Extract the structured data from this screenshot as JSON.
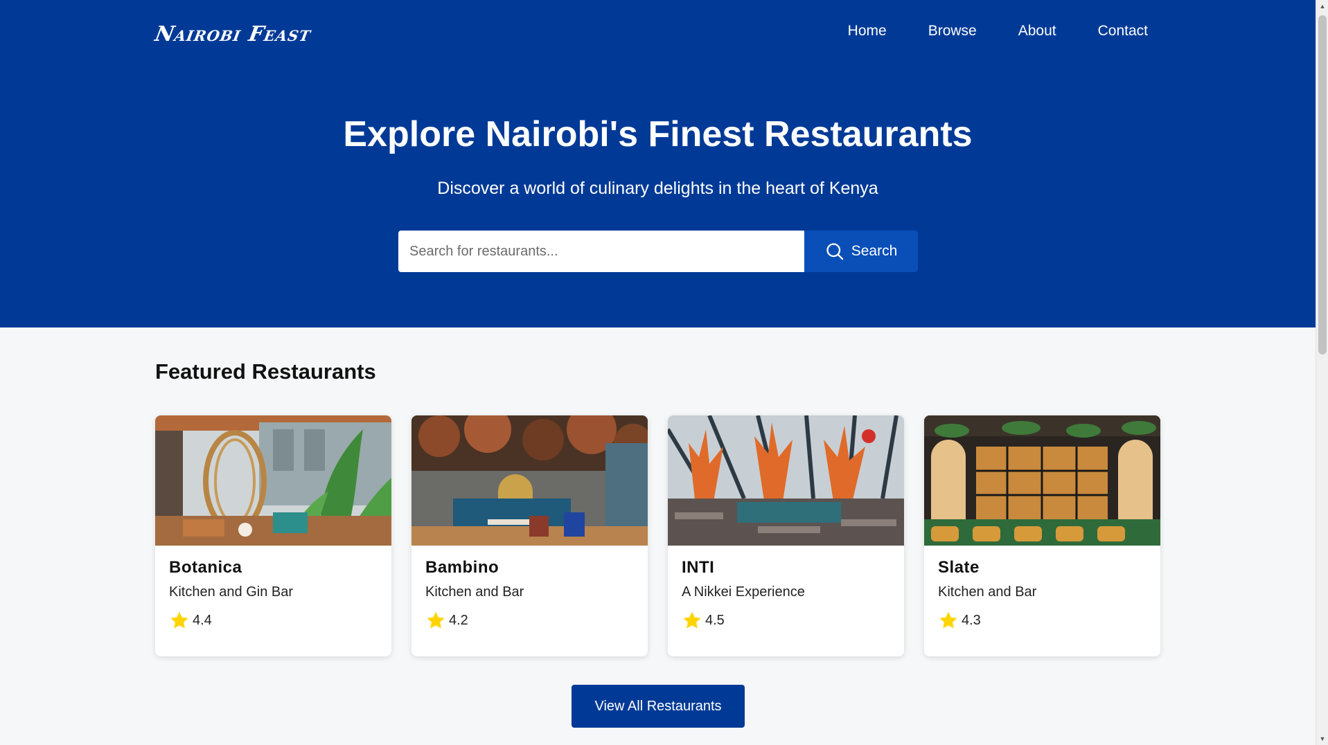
{
  "header": {
    "logo": "Nairobi Feast",
    "nav": [
      "Home",
      "Browse",
      "About",
      "Contact"
    ]
  },
  "hero": {
    "title": "Explore Nairobi's Finest Restaurants",
    "subtitle": "Discover a world of culinary delights in the heart of Kenya",
    "search_placeholder": "Search for restaurants...",
    "search_button": "Search"
  },
  "featured": {
    "title": "Featured Restaurants",
    "restaurants": [
      {
        "name": "Botanica",
        "description": "Kitchen and Gin Bar",
        "rating": "4.4"
      },
      {
        "name": "Bambino",
        "description": "Kitchen and Bar",
        "rating": "4.2"
      },
      {
        "name": "INTI",
        "description": "A Nikkei Experience",
        "rating": "4.5"
      },
      {
        "name": "Slate",
        "description": "Kitchen and Bar",
        "rating": "4.3"
      }
    ],
    "view_all": "View All Restaurants"
  },
  "colors": {
    "primary": "#013a96",
    "button": "#0a4fb8",
    "star": "#ffd400",
    "background": "#f6f7f8"
  }
}
